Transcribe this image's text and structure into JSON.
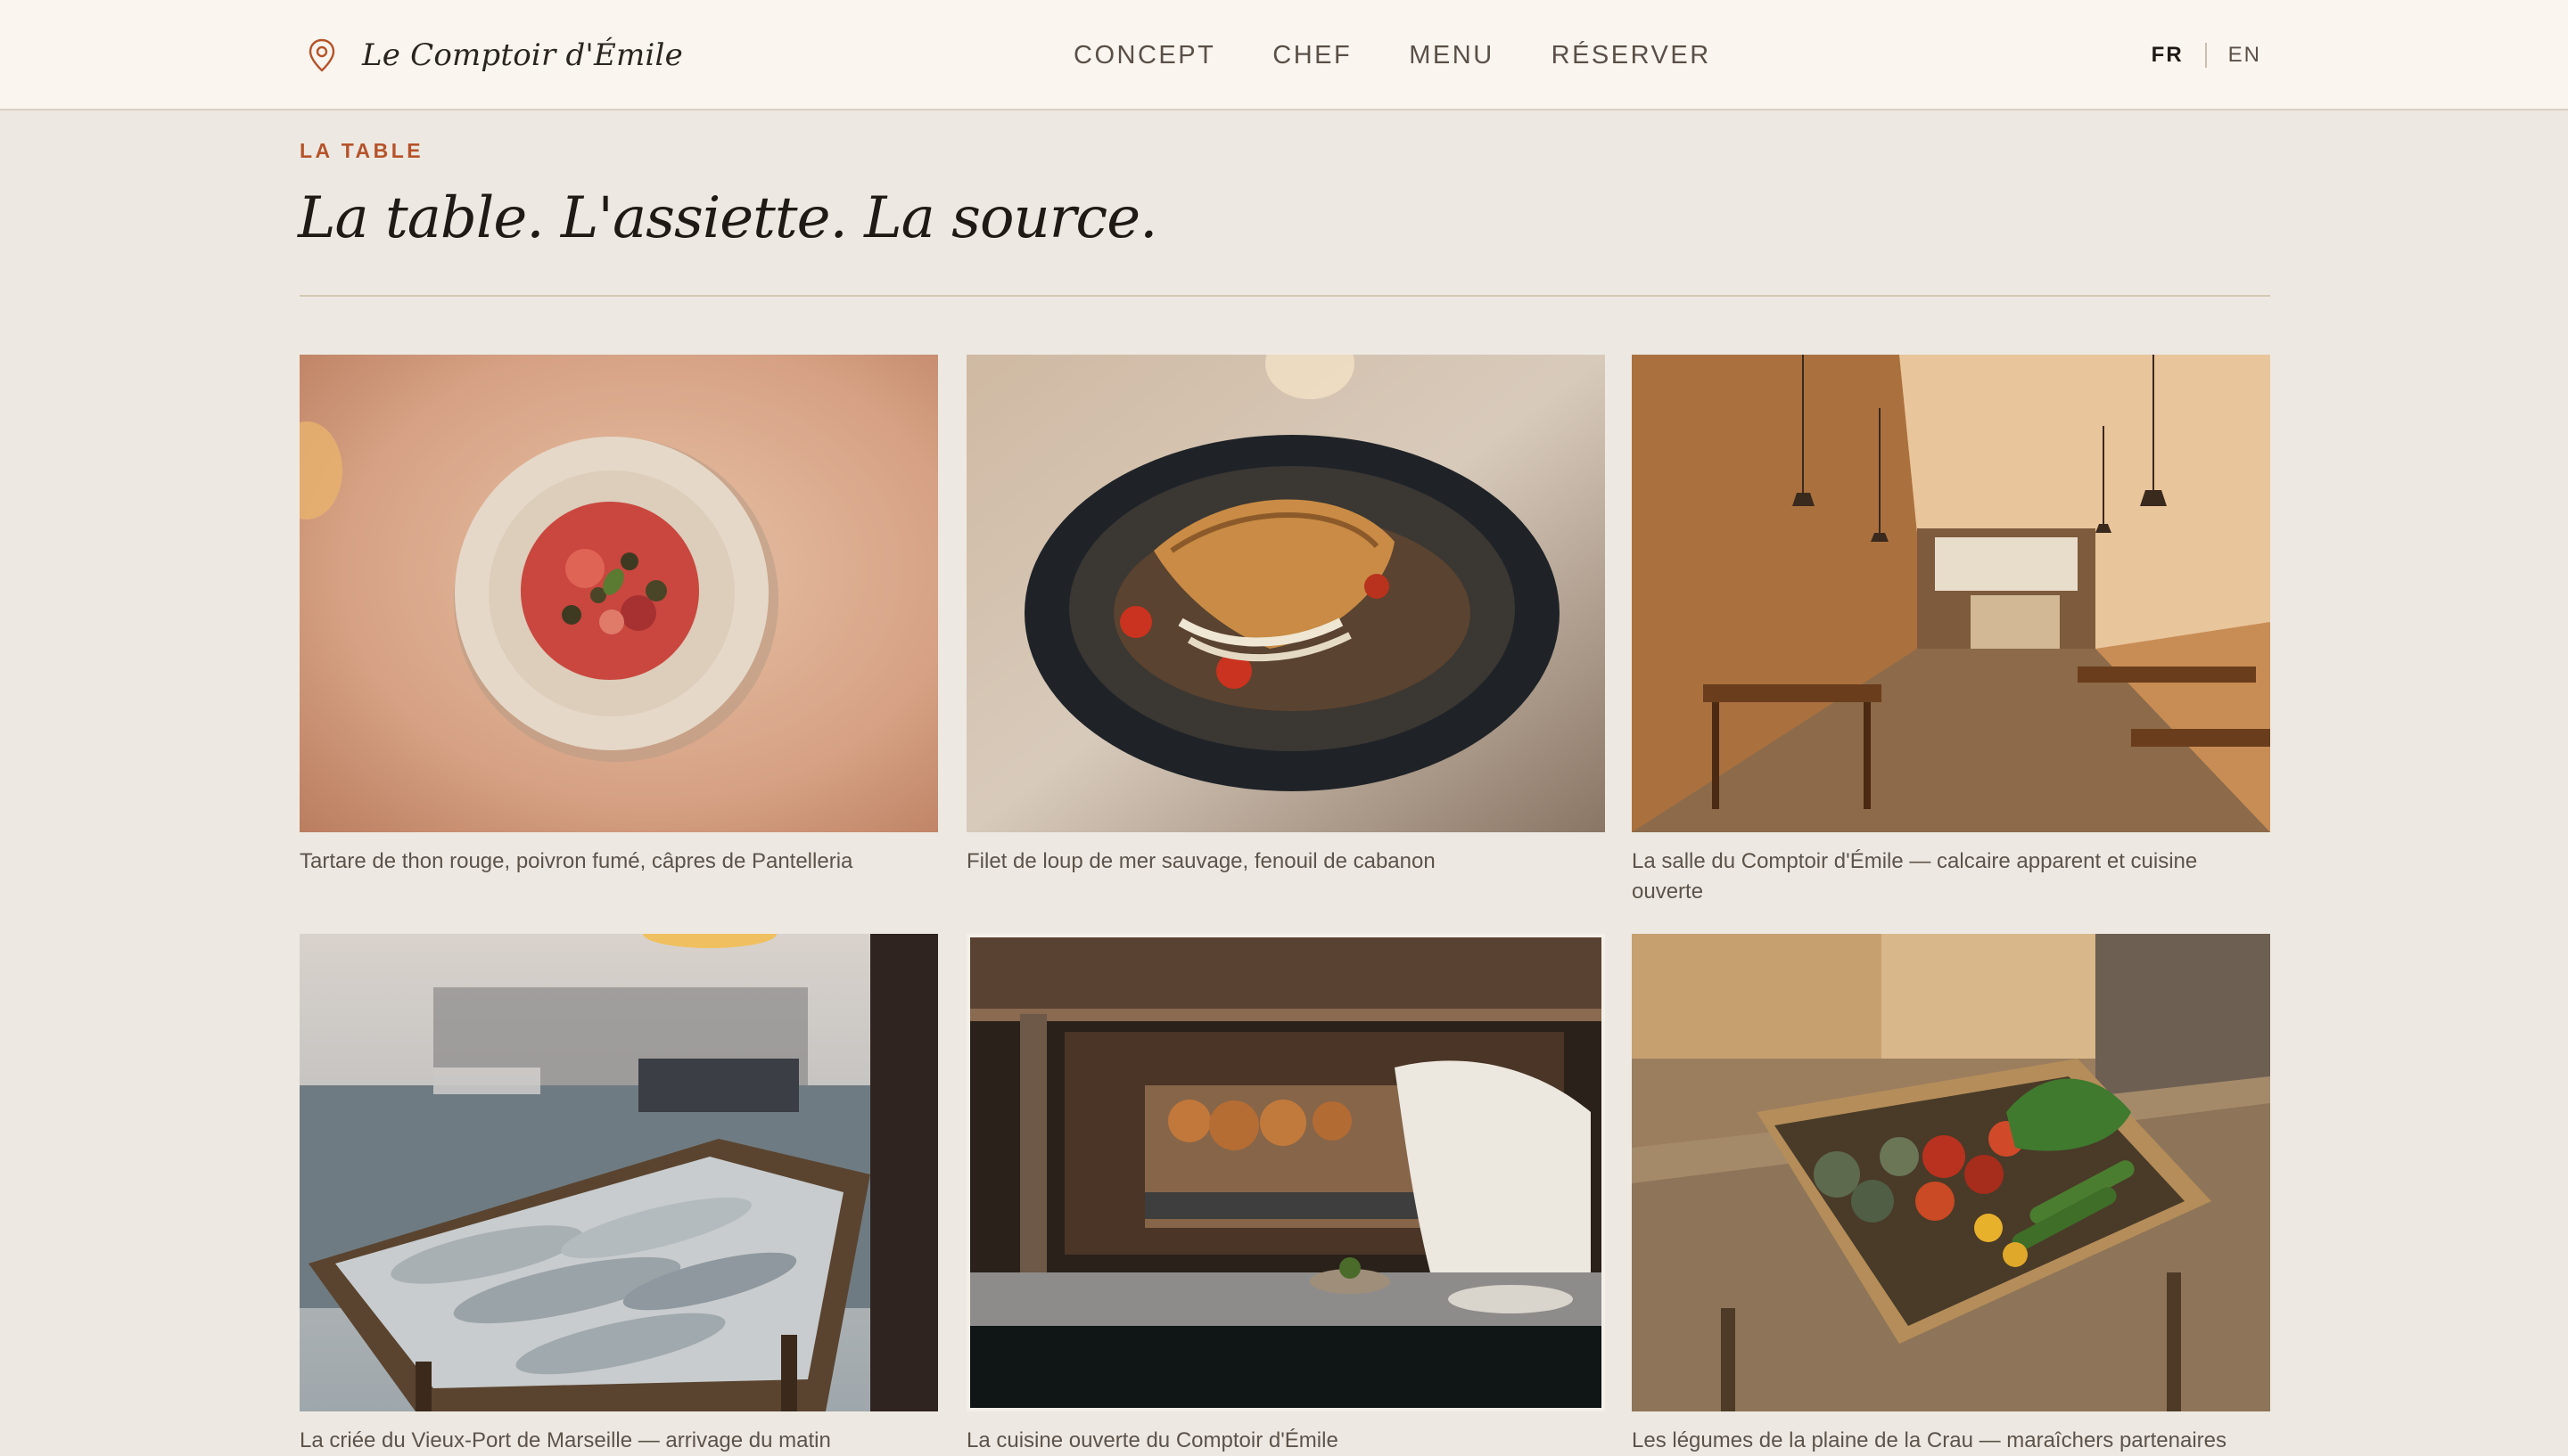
{
  "brand": {
    "name": "Le Comptoir d'Émile",
    "icon": "map-pin-icon"
  },
  "nav": {
    "items": [
      "CONCEPT",
      "CHEF",
      "MENU",
      "RÉSERVER"
    ]
  },
  "lang": {
    "options": [
      "FR",
      "EN"
    ],
    "active": "FR"
  },
  "section": {
    "eyebrow": "LA TABLE",
    "title": "La table. L'assiette. La source."
  },
  "gallery": [
    {
      "caption": "Tartare de thon rouge, poivron fumé, câpres de Pantelleria",
      "image": "tuna-tartare-photo"
    },
    {
      "caption": "Filet de loup de mer sauvage, fenouil de cabanon",
      "image": "sea-bass-photo"
    },
    {
      "caption": "La salle du Comptoir d'Émile — calcaire apparent et cuisine ouverte",
      "image": "dining-room-photo"
    },
    {
      "caption": "La criée du Vieux-Port de Marseille — arrivage du matin",
      "image": "fish-market-photo"
    },
    {
      "caption": "La cuisine ouverte du Comptoir d'Émile",
      "image": "open-kitchen-photo"
    },
    {
      "caption": "Les légumes de la plaine de la Crau — maraîchers partenaires",
      "image": "vegetable-crate-photo"
    }
  ],
  "colors": {
    "accent": "#b5532a",
    "background": "#ede9e2",
    "header": "#faf5ef"
  }
}
